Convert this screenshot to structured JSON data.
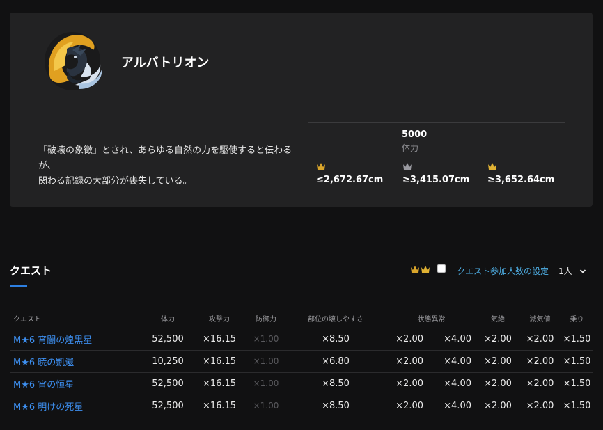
{
  "monster": {
    "name": "アルバトリオン",
    "icon": "alatreon-monster-icon",
    "description_line1": "「破壊の象徴」とされ、あらゆる自然の力を駆使すると伝わるが、",
    "description_line2": "関わる記録の大部分が喪失している。",
    "hp_value": "5000",
    "hp_label": "体力",
    "sizes": [
      {
        "crown": "gold-mini-crown",
        "color": "#d9a52b",
        "value": "≤2,672.67cm"
      },
      {
        "crown": "silver-crown",
        "color": "#9a9aa0",
        "value": "≥3,415.07cm"
      },
      {
        "crown": "gold-crown",
        "color": "#e0b233",
        "value": "≥3,652.64cm"
      }
    ]
  },
  "quests": {
    "title": "クエスト",
    "party_label": "クエスト参加人数の設定",
    "party_value": "1人",
    "headers": [
      "クエスト",
      "体力",
      "攻撃力",
      "防御力",
      "部位の壊しやすさ",
      "状態異常",
      "気絶",
      "滅気値",
      "乗り"
    ],
    "rows": [
      {
        "name": "M★6 宵闇の煌黒星",
        "hp": "52,500",
        "attack": "×16.15",
        "defense": "×1.00",
        "parts": "×8.50",
        "ail_1": "×2.00",
        "ail_2": "×4.00",
        "stun": "×2.00",
        "exhaust": "×2.00",
        "mount": "×1.50"
      },
      {
        "name": "M★6 暁の凱還",
        "hp": "10,250",
        "attack": "×16.15",
        "defense": "×1.00",
        "parts": "×6.80",
        "ail_1": "×2.00",
        "ail_2": "×4.00",
        "stun": "×2.00",
        "exhaust": "×2.00",
        "mount": "×1.50"
      },
      {
        "name": "M★6 宵の恒星",
        "hp": "52,500",
        "attack": "×16.15",
        "defense": "×1.00",
        "parts": "×8.50",
        "ail_1": "×2.00",
        "ail_2": "×4.00",
        "stun": "×2.00",
        "exhaust": "×2.00",
        "mount": "×1.50"
      },
      {
        "name": "M★6 明けの死星",
        "hp": "52,500",
        "attack": "×16.15",
        "defense": "×1.00",
        "parts": "×8.50",
        "ail_1": "×2.00",
        "ail_2": "×4.00",
        "stun": "×2.00",
        "exhaust": "×2.00",
        "mount": "×1.50"
      }
    ]
  }
}
